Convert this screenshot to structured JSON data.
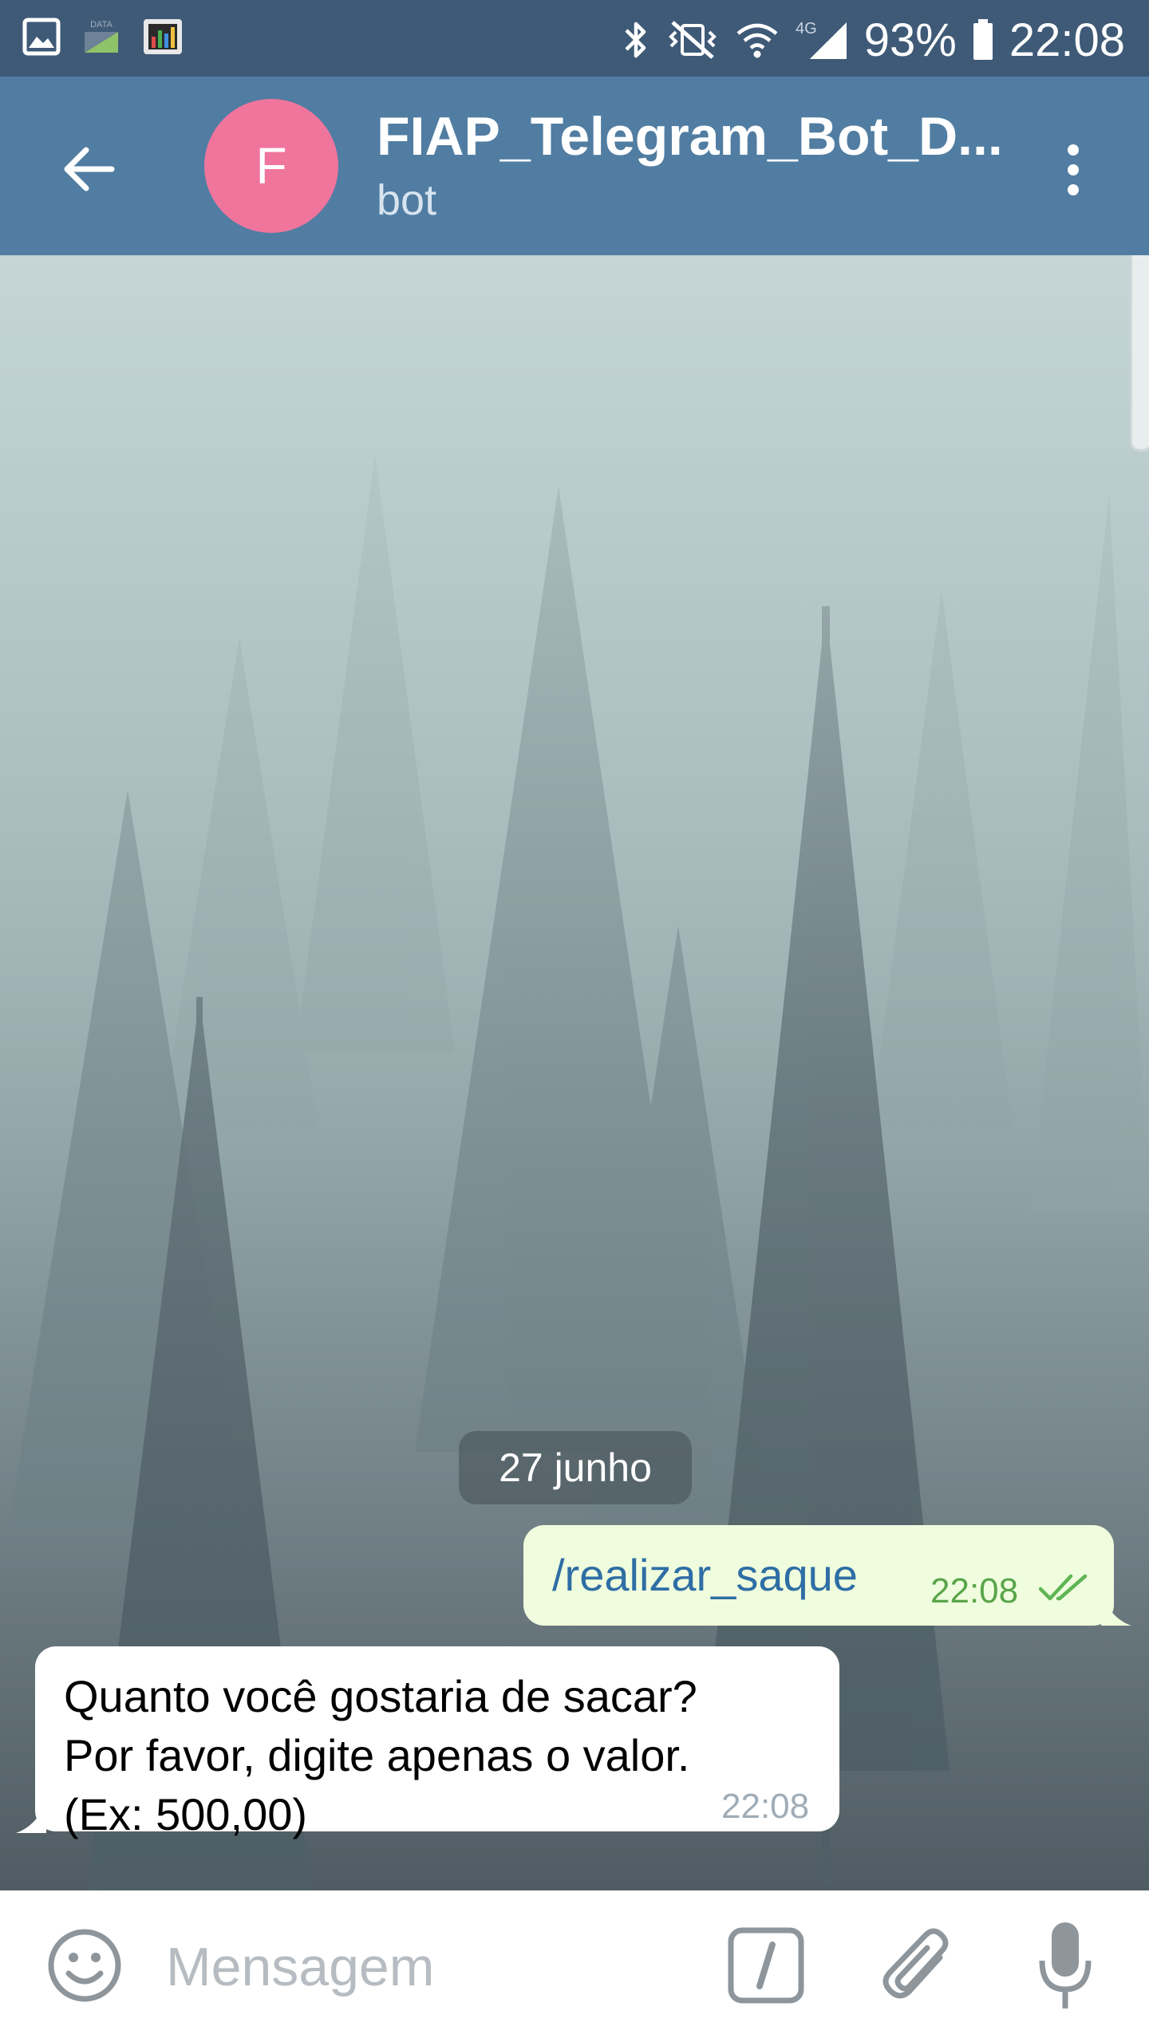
{
  "status_bar": {
    "battery": "93%",
    "time": "22:08",
    "network": "4G",
    "data_label": "DATA"
  },
  "header": {
    "avatar_letter": "F",
    "title": "FIAP_Telegram_Bot_D...",
    "subtitle": "bot",
    "avatar_color": "#f0759d",
    "bar_color": "#517da2"
  },
  "chat": {
    "date_separator": "27 junho",
    "messages": [
      {
        "direction": "outgoing",
        "text": "/realizar_saque",
        "time": "22:08",
        "status": "read"
      },
      {
        "direction": "incoming",
        "lines": [
          "Quanto você gostaria de sacar?",
          "Por favor, digite apenas o valor.",
          "(Ex: 500,00)"
        ],
        "time": "22:08"
      }
    ]
  },
  "input": {
    "placeholder": "Mensagem"
  },
  "icons": {
    "back": "arrow-left-icon",
    "menu": "more-vertical-icon",
    "emoji": "smiley-icon",
    "command": "slash-command-icon",
    "attach": "paperclip-icon",
    "mic": "microphone-icon"
  }
}
